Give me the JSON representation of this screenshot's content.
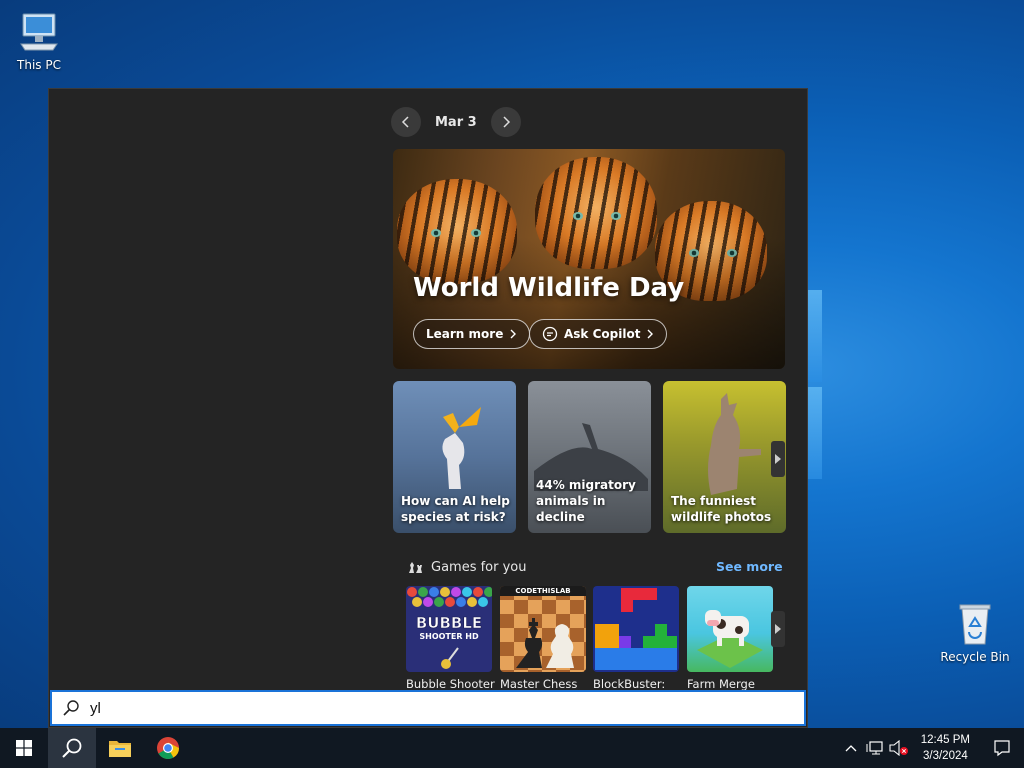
{
  "desktop": {
    "icons": [
      {
        "label": "This PC",
        "icon": "computer-icon"
      },
      {
        "label": "Recycle Bin",
        "icon": "recycle-bin-icon"
      }
    ]
  },
  "panel": {
    "date": "Mar 3",
    "hero": {
      "title": "World Wildlife Day",
      "buttons": [
        {
          "label": "Learn more",
          "icon": "chevron-right-icon"
        },
        {
          "label": "Ask Copilot",
          "icon": "chat-bubble-icon"
        }
      ]
    },
    "cards": [
      {
        "caption": "How can AI help species at risk?"
      },
      {
        "caption": "44% migratory animals in decline"
      },
      {
        "caption": "The funniest wildlife photos"
      }
    ],
    "games": {
      "heading": "Games for you",
      "see_more": "See more",
      "items": [
        {
          "title": "Bubble Shooter",
          "art_text": "BUBBLE",
          "art_sub": "SHOOTER HD"
        },
        {
          "title": "Master Chess",
          "art_text": "CODETHISLAB"
        },
        {
          "title": "BlockBuster:"
        },
        {
          "title": "Farm Merge"
        }
      ]
    }
  },
  "search": {
    "value": "yl",
    "icon": "search-icon"
  },
  "taskbar": {
    "apps": [
      {
        "name": "start",
        "icon": "windows-logo-icon"
      },
      {
        "name": "search",
        "icon": "search-icon"
      },
      {
        "name": "file-explorer",
        "icon": "folder-icon"
      },
      {
        "name": "chrome",
        "icon": "chrome-icon"
      }
    ],
    "time": "12:45 PM",
    "date": "3/3/2024"
  }
}
